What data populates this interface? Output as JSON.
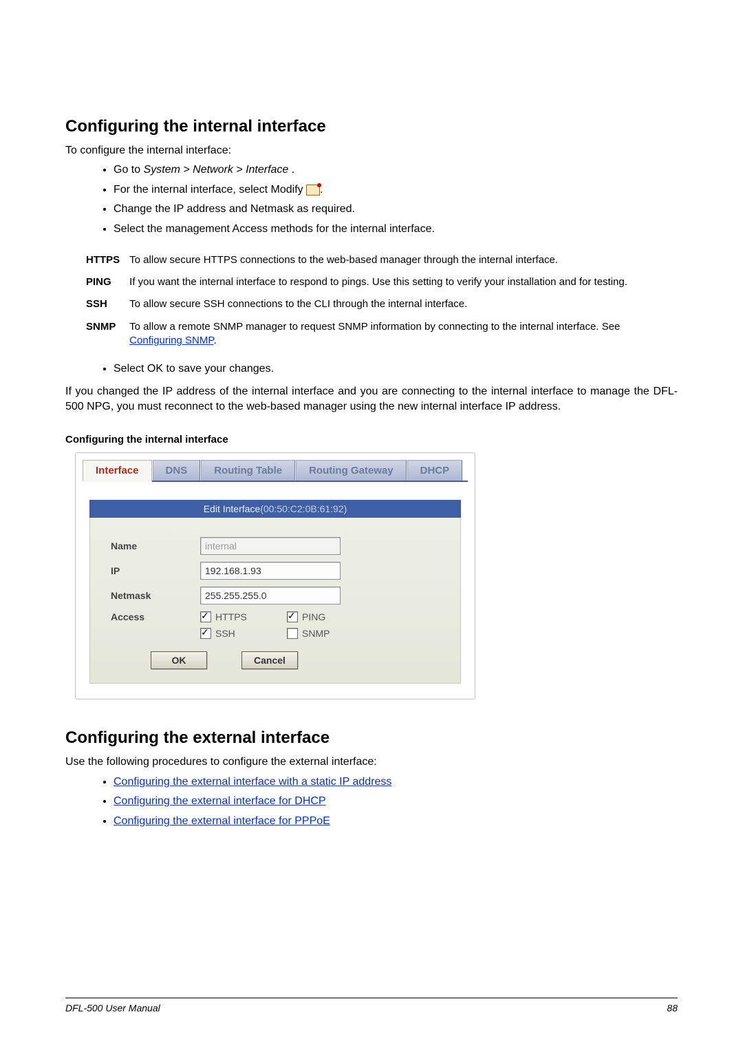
{
  "section1": {
    "heading": "Configuring the internal interface",
    "intro": "To configure the internal interface:",
    "bullets_a": [
      {
        "pre": "Go to ",
        "path": "System > Network > Interface",
        "post": " ."
      },
      {
        "text_pre": "For the internal interface, select Modify ",
        "text_post": "."
      },
      {
        "plain": "Change the IP address and Netmask as required."
      },
      {
        "plain": "Select the management Access methods for the internal interface."
      }
    ],
    "access_table": {
      "https": {
        "label": "HTTPS",
        "desc": "To allow secure HTTPS connections to the web-based manager through the internal interface."
      },
      "ping": {
        "label": "PING",
        "desc": "If you want the internal interface to respond to pings. Use this setting to verify your installation and for testing."
      },
      "ssh": {
        "label": "SSH",
        "desc": "To allow secure SSH connections to the CLI through the internal interface."
      },
      "snmp": {
        "label": "SNMP",
        "desc_pre": "To allow a remote SNMP manager to request SNMP information by connecting to the internal interface. See ",
        "link": "Configuring SNMP",
        "desc_post": "."
      }
    },
    "bullets_b": [
      {
        "plain": "Select OK to save your changes."
      }
    ],
    "note": "If you changed the IP address of the internal interface and you are connecting to the internal interface to manage the DFL-500 NPG, you must reconnect to the web-based manager using the new internal interface IP address.",
    "caption": "Configuring the internal interface"
  },
  "panel": {
    "tabs": {
      "interface": "Interface",
      "dns": "DNS",
      "routing_table": "Routing Table",
      "routing_gateway": "Routing Gateway",
      "dhcp": "DHCP"
    },
    "header_label": "Edit Interface",
    "header_mac": "(00:50:C2:0B:61:92)",
    "labels": {
      "name": "Name",
      "ip": "IP",
      "netmask": "Netmask",
      "access": "Access"
    },
    "values": {
      "name": "internal",
      "ip": "192.168.1.93",
      "netmask": "255.255.255.0"
    },
    "checkboxes": {
      "https": {
        "label": "HTTPS",
        "checked": true
      },
      "ping": {
        "label": "PING",
        "checked": true
      },
      "ssh": {
        "label": "SSH",
        "checked": true
      },
      "snmp": {
        "label": "SNMP",
        "checked": false
      }
    },
    "buttons": {
      "ok": "OK",
      "cancel": "Cancel"
    }
  },
  "section2": {
    "heading": "Configuring the external interface",
    "intro": "Use the following procedures to configure the external interface:",
    "links": [
      "Configuring the external interface with a static IP address",
      "Configuring the external interface for DHCP",
      "Configuring the external interface for PPPoE"
    ]
  },
  "footer": {
    "manual": "DFL-500 User Manual",
    "page": "88"
  }
}
